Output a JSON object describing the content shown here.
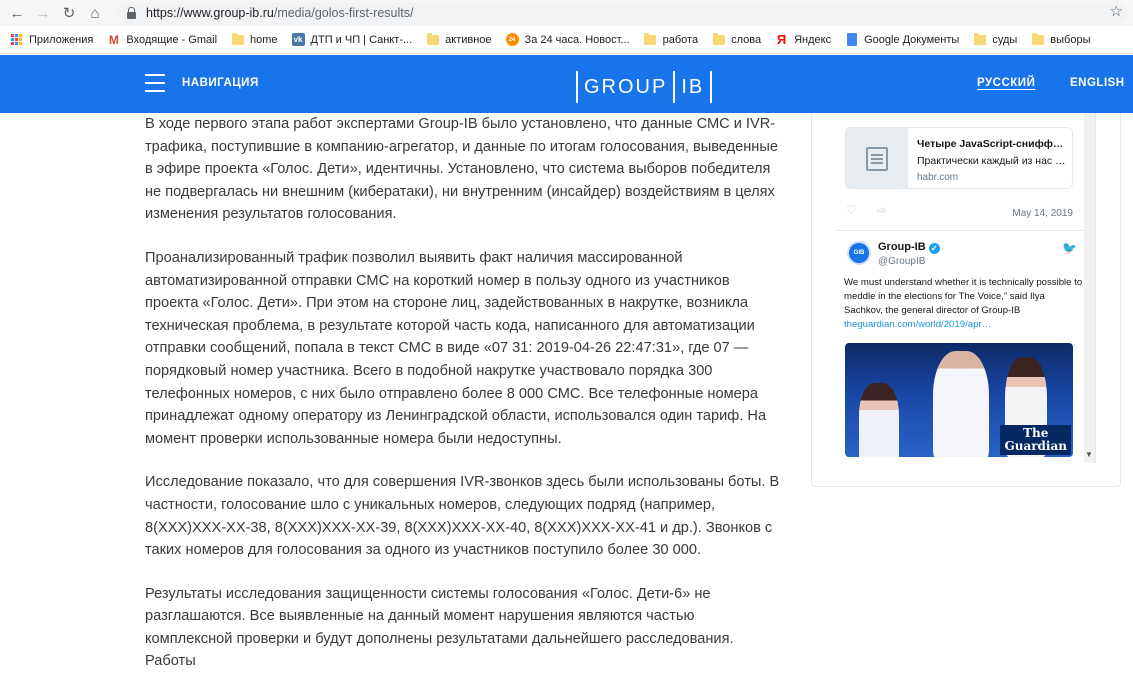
{
  "browser": {
    "url_prefix": "https://www.group-ib.ru",
    "url_path": "/media/golos-first-results/",
    "bookmarks": [
      {
        "label": "Приложения",
        "icon": "apps-icon"
      },
      {
        "label": "Входящие - Gmail",
        "icon": "gmail-icon"
      },
      {
        "label": "home",
        "icon": "folder-icon"
      },
      {
        "label": "ДТП и ЧП | Санкт-...",
        "icon": "vk-icon"
      },
      {
        "label": "активное",
        "icon": "folder-icon"
      },
      {
        "label": "За 24 часа. Новост...",
        "icon": "news24-icon"
      },
      {
        "label": "работа",
        "icon": "folder-icon"
      },
      {
        "label": "слова",
        "icon": "folder-icon"
      },
      {
        "label": "Яндекс",
        "icon": "yandex-icon"
      },
      {
        "label": "Google Документы",
        "icon": "gdocs-icon"
      },
      {
        "label": "суды",
        "icon": "folder-icon"
      },
      {
        "label": "выборы",
        "icon": "folder-icon"
      }
    ]
  },
  "header": {
    "nav_label": "НАВИГАЦИЯ",
    "logo_left": "GROUP",
    "logo_right": "IB",
    "lang_ru": "РУССКИЙ",
    "lang_en": "ENGLISH",
    "brand_color": "#1774eb"
  },
  "article": {
    "paragraphs": [
      "В ходе первого этапа работ экспертами Group-IB было установлено, что данные СМС и IVR-трафика, поступившие в компанию-агрегатор, и данные по итогам голосования, выведенные в эфире проекта «Голос. Дети», идентичны. Установлено, что система выборов победителя не подвергалась ни внешним (кибератаки), ни внутренним (инсайдер) воздействиям в целях изменения результатов голосования.",
      "Проанализированный трафик позволил выявить факт наличия массированной автоматизированной отправки СМС на короткий номер в пользу одного из участников проекта «Голос. Дети». При этом на стороне лиц, задействованных в накрутке, возникла техническая проблема, в результате которой часть кода, написанного для автоматизации отправки сообщений, попала в текст СМС в виде «07 31: 2019-04-26 22:47:31», где 07 — порядковый номер участника. Всего в подобной накрутке участвовало порядка 300 телефонных номеров, с них было отправлено более 8 000 СМС. Все телефонные номера принадлежат одному оператору из Ленинградской области, использовался один тариф. На момент проверки использованные номера были недоступны.",
      "Исследование показало, что для совершения IVR-звонков здесь были использованы боты. В частности, голосование шло с уникальных номеров, следующих подряд (например, 8(XXX)XXX-XX-38, 8(XXX)XXX-XX-39, 8(XXX)XXX-XX-40, 8(XXX)XXX-XX-41 и др.). Звонков с таких номеров для голосования за одного из участников поступило более 30 000.",
      "Результаты исследования защищенности системы голосования «Голос. Дети-6» не разглашаются. Все выявленные на данный момент нарушения являются частью комплексной проверки и будут дополнены результатами дальнейшего расследования. Работы"
    ]
  },
  "twitter": {
    "card_title": "Четыре JavaScript-сниффера...",
    "card_desc": "Практически каждый из нас п...",
    "card_domain": "habr.com",
    "date": "May 14, 2019",
    "avatar_text": "GIB",
    "name": "Group-IB",
    "handle": "@GroupIB",
    "tweet_text": "We must understand whether it is technically possible to meddle in the elections for The Voice,” said Ilya Sachkov, the general director of Group-IB",
    "tweet_link": "theguardian.com/world/2019/apr…",
    "image_badge_line1": "The",
    "image_badge_line2": "Guardian"
  }
}
